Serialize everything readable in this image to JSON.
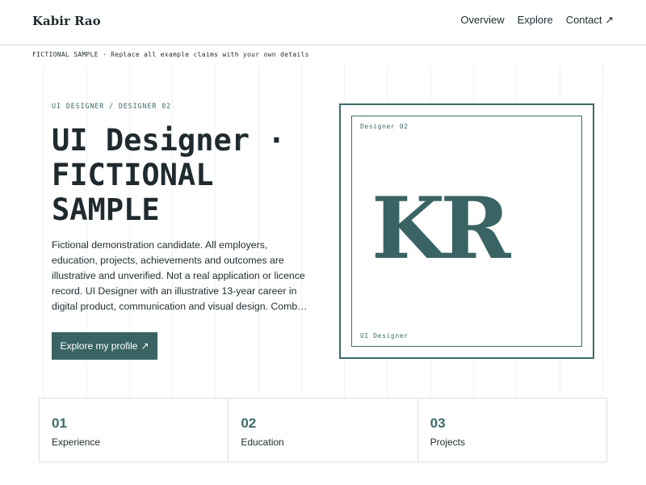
{
  "header": {
    "brand": "Kabir Rao",
    "nav": [
      {
        "label": "Overview"
      },
      {
        "label": "Explore"
      },
      {
        "label": "Contact ↗"
      }
    ]
  },
  "notice": "FICTIONAL SAMPLE · Replace all example claims with your own details",
  "hero": {
    "eyebrow": "UI DESIGNER / DESIGNER 02",
    "title": "UI Designer · FICTIONAL SAMPLE",
    "description": "Fictional demonstration candidate. All employers, education, projects, achievements and outcomes are illustrative and unverified. Not a real application or licence record. UI Designer with an illustrative 13-year career in digital product, communication and visual design. Comb…",
    "cta_label": "Explore my profile",
    "cta_icon": "↗"
  },
  "card": {
    "top_label": "Designer 02",
    "monogram": "KR",
    "bottom_label": "UI Designer"
  },
  "stats": [
    {
      "number": "01",
      "label": "Experience"
    },
    {
      "number": "02",
      "label": "Education"
    },
    {
      "number": "03",
      "label": "Projects"
    }
  ],
  "colors": {
    "accent": "#3a6464",
    "text": "#1f2a2e"
  }
}
